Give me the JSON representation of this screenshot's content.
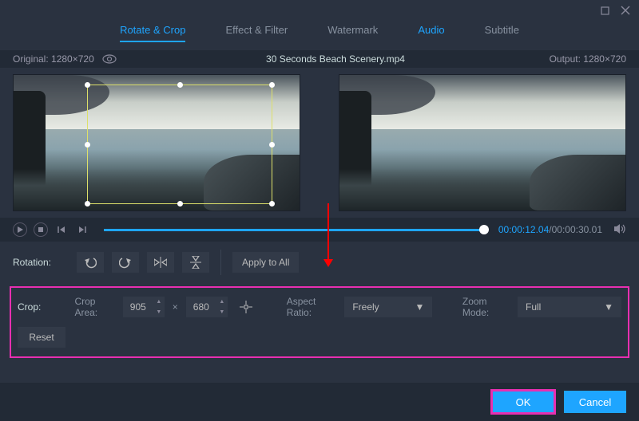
{
  "window": {
    "maximize_name": "maximize",
    "close_name": "close"
  },
  "tabs": {
    "rotate_crop": "Rotate & Crop",
    "effect_filter": "Effect & Filter",
    "watermark": "Watermark",
    "audio": "Audio",
    "subtitle": "Subtitle"
  },
  "info": {
    "original": "Original: 1280×720",
    "title": "30 Seconds Beach Scenery.mp4",
    "output": "Output: 1280×720"
  },
  "playback": {
    "current_time": "00:00:12.04",
    "total_time": "/00:00:30.01"
  },
  "rotation": {
    "label": "Rotation:",
    "apply_all": "Apply to All"
  },
  "crop": {
    "label": "Crop:",
    "area_label": "Crop Area:",
    "width": "905",
    "height": "680",
    "times": "×",
    "aspect_label": "Aspect Ratio:",
    "aspect_value": "Freely",
    "zoom_label": "Zoom Mode:",
    "zoom_value": "Full",
    "reset": "Reset"
  },
  "footer": {
    "ok": "OK",
    "cancel": "Cancel"
  }
}
